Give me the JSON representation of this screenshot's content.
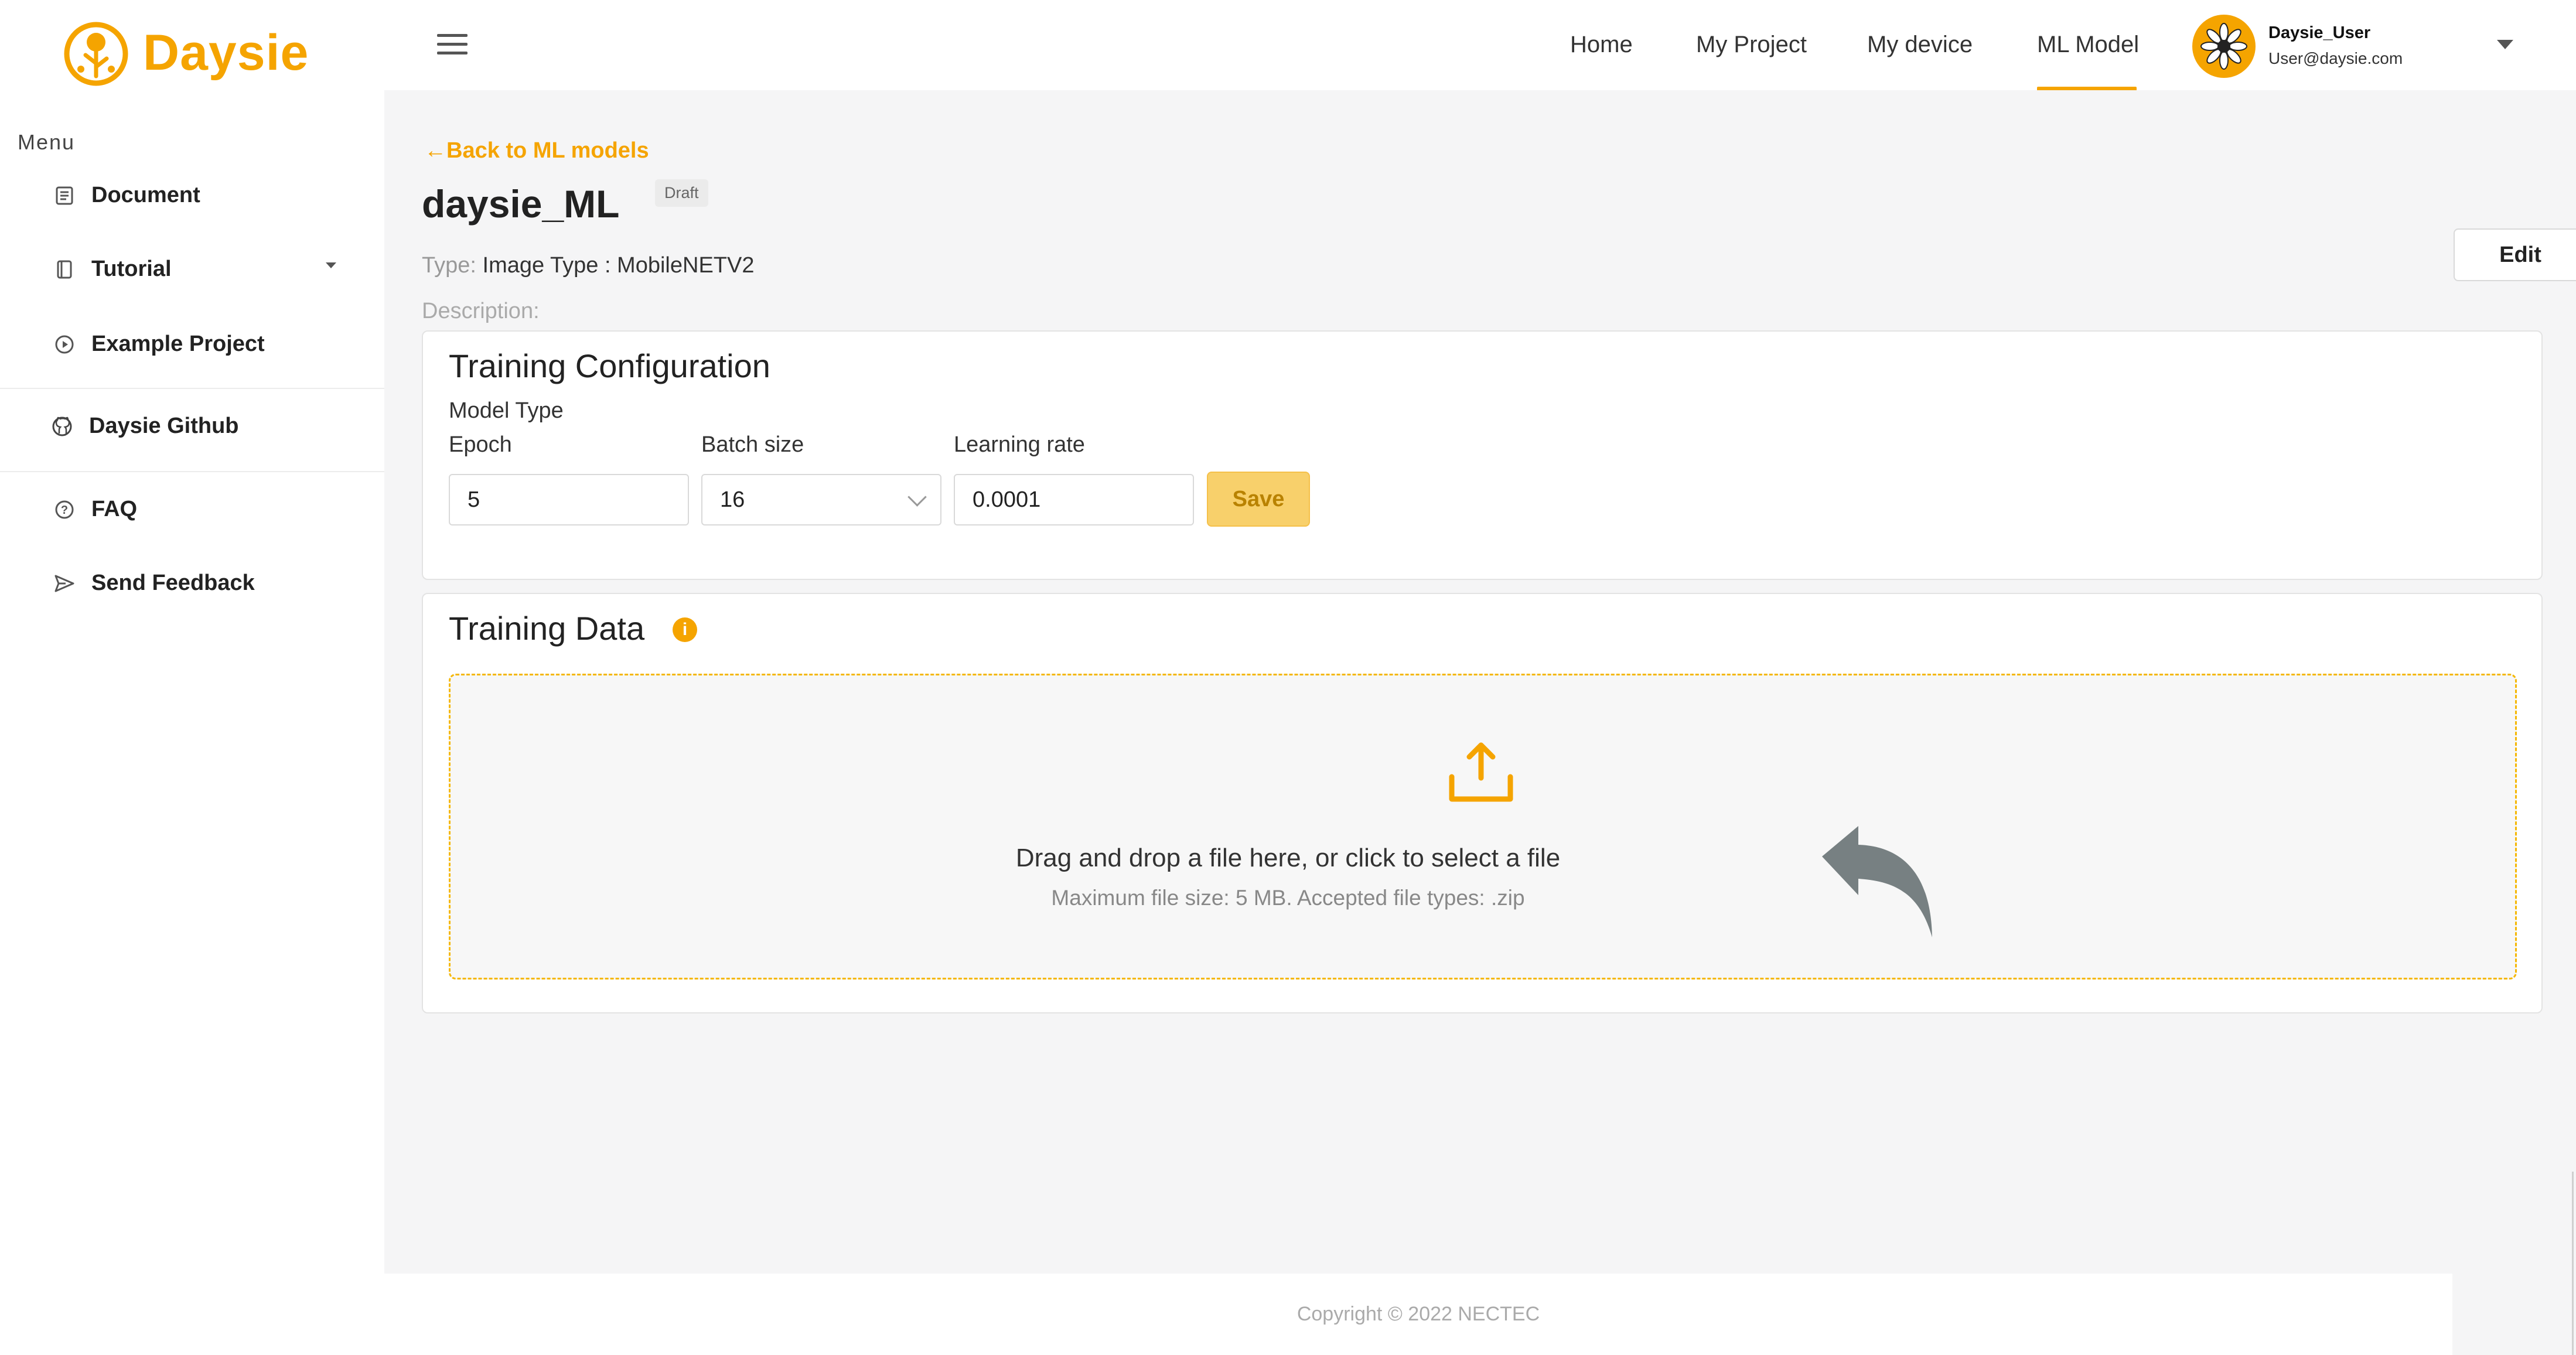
{
  "brand": {
    "name": "Daysie",
    "accent": "#f5a400"
  },
  "sidebar": {
    "menu_heading": "Menu",
    "items": [
      {
        "label": "Document",
        "icon": "document-icon"
      },
      {
        "label": "Tutorial",
        "icon": "book-icon",
        "has_submenu": true
      },
      {
        "label": "Example Project",
        "icon": "play-circle-icon"
      },
      {
        "label": "Daysie Github",
        "icon": "github-icon"
      },
      {
        "label": "FAQ",
        "icon": "question-circle-icon"
      },
      {
        "label": "Send Feedback",
        "icon": "send-icon"
      }
    ]
  },
  "header": {
    "nav": [
      "Home",
      "My Project",
      "My device",
      "ML Model"
    ],
    "active_nav": "ML Model",
    "user": {
      "name": "Daysie_User",
      "email": "User@daysie.com"
    }
  },
  "page": {
    "back_link": "Back to ML models",
    "title": "daysie_ML",
    "status_badge": "Draft",
    "type_label": "Type:",
    "type_value": "Image Type : MobileNETV2",
    "description_label": "Description:",
    "edit_button": "Edit"
  },
  "training_config": {
    "title": "Training Configuration",
    "model_type_label": "Model Type",
    "epoch_label": "Epoch",
    "epoch_value": "5",
    "batch_label": "Batch size",
    "batch_value": "16",
    "lr_label": "Learning rate",
    "lr_value": "0.0001",
    "save_button": "Save"
  },
  "training_data": {
    "title": "Training Data",
    "info_icon": "i",
    "dropzone_text": "Drag and drop a file here, or click to select a file",
    "dropzone_subtext": "Maximum file size: 5 MB. Accepted file types: .zip"
  },
  "footer": {
    "copyright": "Copyright © 2022 NECTEC"
  }
}
